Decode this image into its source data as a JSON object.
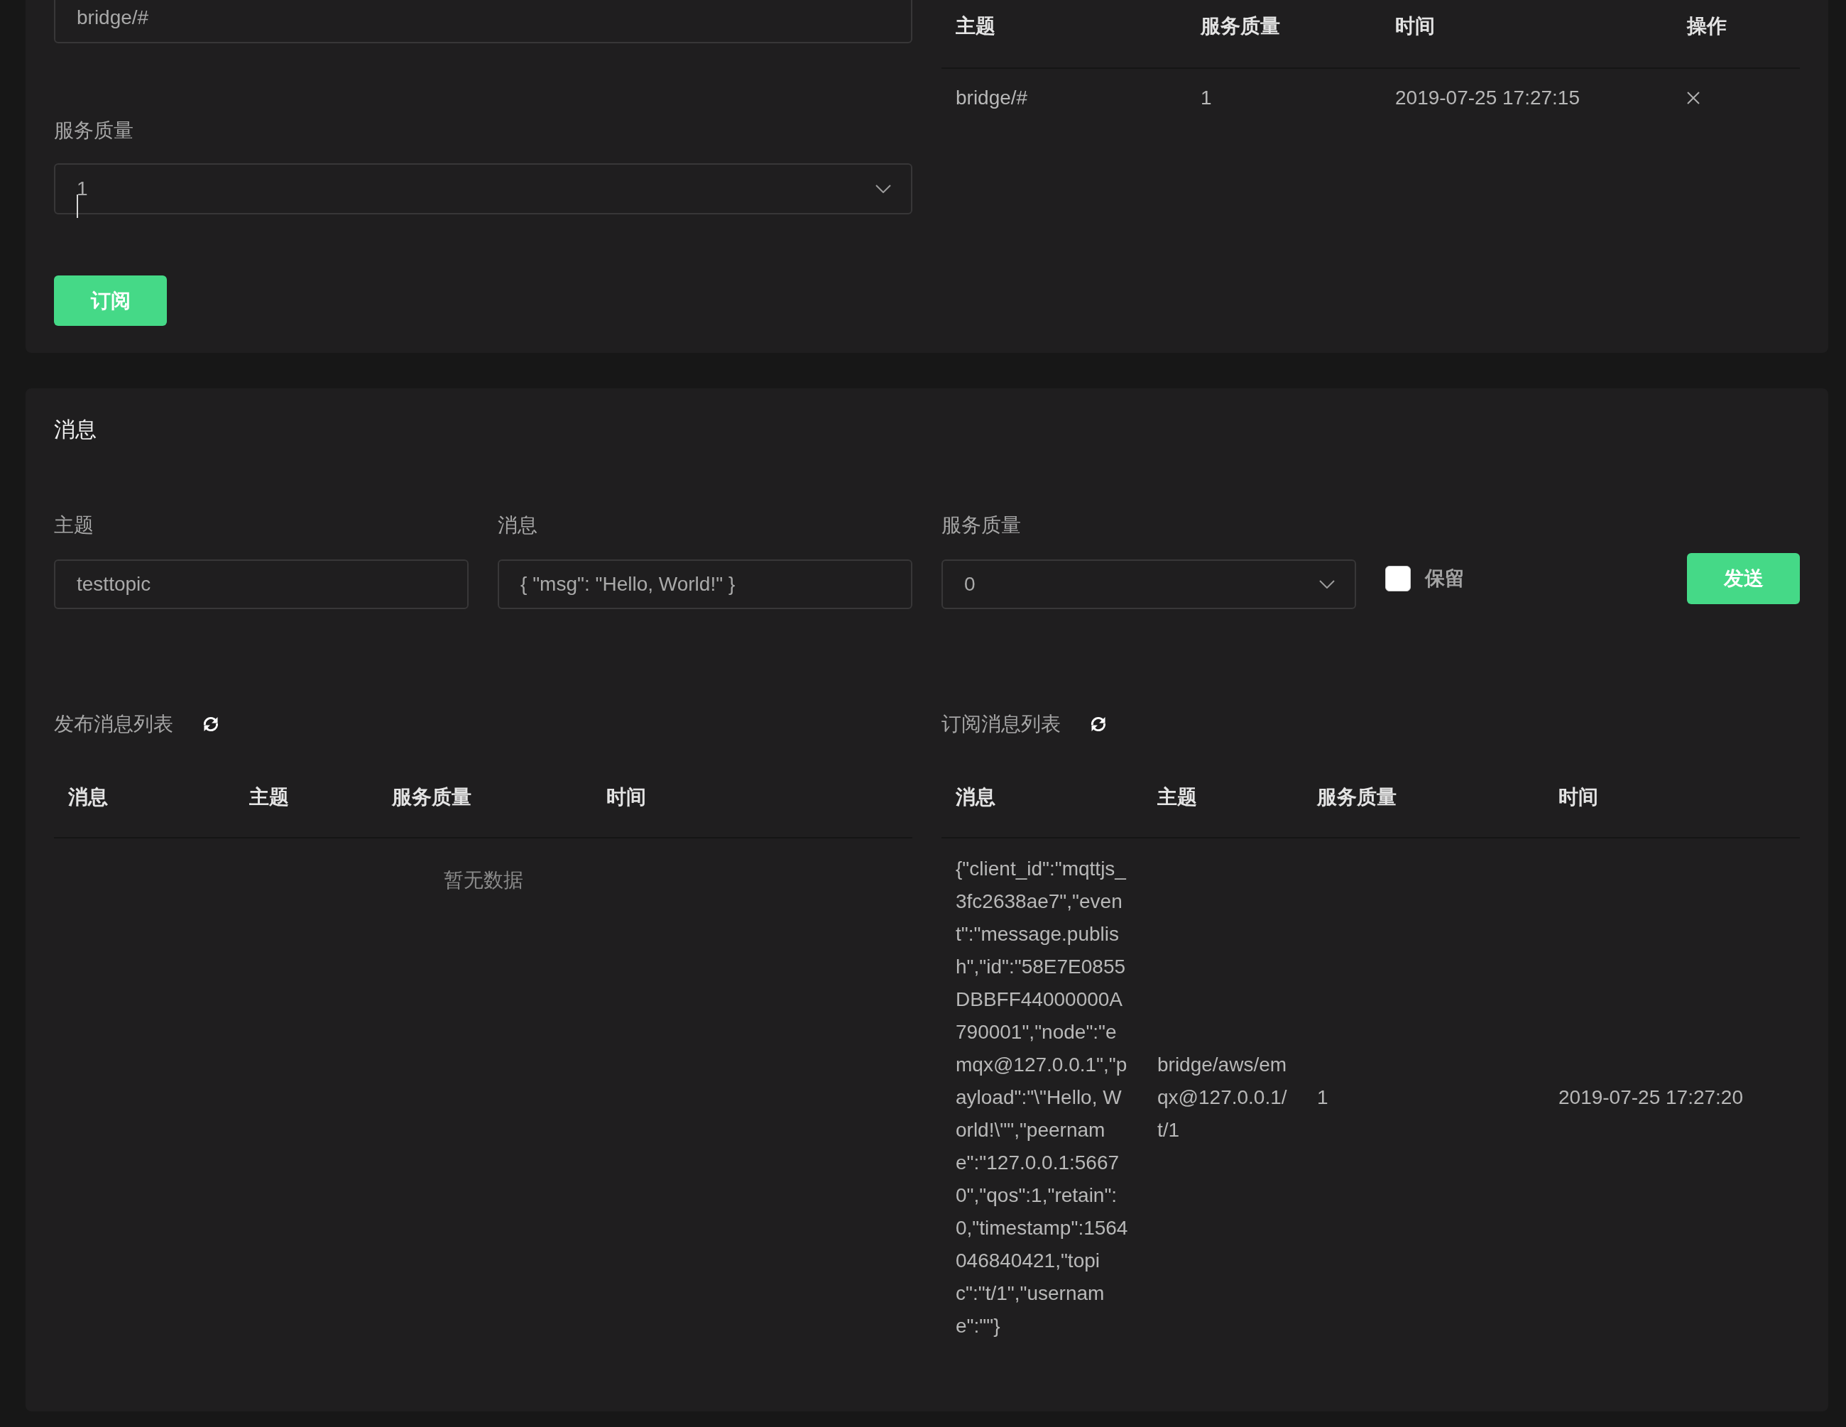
{
  "subscription": {
    "topic_field": {
      "value": "bridge/#"
    },
    "qos_label": "服务质量",
    "qos_select": {
      "value": "1"
    },
    "subscribe_button": "订阅",
    "table": {
      "columns": [
        "主题",
        "服务质量",
        "时间",
        "操作"
      ],
      "rows": [
        {
          "cells": [
            "bridge/#",
            "1",
            "2019-07-25 17:27:15"
          ]
        }
      ]
    }
  },
  "message": {
    "title": "消息",
    "fields": [
      {
        "kind": "input",
        "label": "主题",
        "value": "testtopic"
      },
      {
        "kind": "input",
        "label": "消息",
        "value": "{ \"msg\": \"Hello, World!\" }"
      },
      {
        "kind": "select",
        "label": "服务质量",
        "value": "0"
      }
    ],
    "retain": {
      "label": "保留",
      "checked": false
    },
    "send_button": "发送",
    "lists": [
      {
        "title": "发布消息列表",
        "columns": [
          "消息",
          "主题",
          "服务质量",
          "时间"
        ],
        "empty_text": "暂无数据"
      },
      {
        "title": "订阅消息列表",
        "columns": [
          "消息",
          "主题",
          "服务质量",
          "时间"
        ],
        "rows": [
          {
            "cells": [
              "{\"client_id\":\"mqttjs_3fc2638ae7\",\"event\":\"message.publish\",\"id\":\"58E7E0855DBBFF44000000A790001\",\"node\":\"emqx@127.0.0.1\",\"payload\":\"\\\"Hello, World!\\\"\",\"peername\":\"127.0.0.1:56670\",\"qos\":1,\"retain\":0,\"timestamp\":1564046840421,\"topic\":\"t/1\",\"username\":\"\"}",
              "bridge/aws/emqx@127.0.0.1/t/1",
              "1",
              "2019-07-25 17:27:20"
            ]
          }
        ]
      }
    ]
  }
}
